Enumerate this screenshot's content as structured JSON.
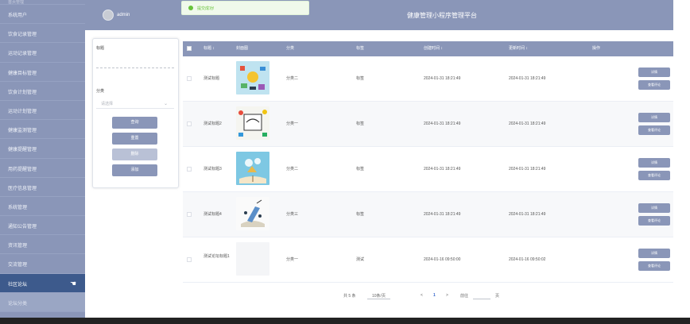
{
  "sidebar": {
    "items": [
      {
        "label": "首页管理"
      },
      {
        "label": "系统用户"
      },
      {
        "label": "饮食记录管理"
      },
      {
        "label": "运动记录管理"
      },
      {
        "label": "健康目标管理"
      },
      {
        "label": "饮食计划管理"
      },
      {
        "label": "运动计划管理"
      },
      {
        "label": "健康监测管理"
      },
      {
        "label": "健康提醒管理"
      },
      {
        "label": "用药提醒管理"
      },
      {
        "label": "医疗信息管理"
      },
      {
        "label": "系统管理"
      },
      {
        "label": "通知公告管理"
      },
      {
        "label": "资讯管理"
      },
      {
        "label": "交流管理"
      },
      {
        "label": "社区论坛"
      },
      {
        "label": "论坛分类"
      }
    ]
  },
  "header": {
    "admin_name": "admin",
    "app_title": "健康管理小程序管理平台"
  },
  "toast": {
    "text": "提交成功!"
  },
  "filter": {
    "title_label": "标题",
    "category_label": "分类",
    "category_placeholder": "请选择",
    "search_label": "查询",
    "reset_label": "重置",
    "delete_label": "删除",
    "add_label": "添加"
  },
  "table": {
    "headers": [
      "标题 ↕",
      "封面图",
      "分类",
      "标签",
      "创建时间 ↕",
      "更新时间 ↕",
      "操作"
    ],
    "rows": [
      {
        "title": "测试标题",
        "category": "分类二",
        "tag": "标签",
        "created": "2024-01-31 18:21:49",
        "updated": "2024-01-31 18:21:49"
      },
      {
        "title": "测试标题2",
        "category": "分类一",
        "tag": "标签",
        "created": "2024-01-31 18:21:49",
        "updated": "2024-01-31 18:21:49"
      },
      {
        "title": "测试标题3",
        "category": "分类二",
        "tag": "标签",
        "created": "2024-01-31 18:21:49",
        "updated": "2024-01-31 18:21:49"
      },
      {
        "title": "测试标题4",
        "category": "分类三",
        "tag": "标签",
        "created": "2024-01-31 18:21:49",
        "updated": "2024-01-31 18:21:49"
      },
      {
        "title": "测试论坛标题1",
        "category": "分类一",
        "tag": "测试",
        "created": "2024-01-16 09:50:00",
        "updated": "2024-01-16 09:50:02"
      }
    ],
    "detail_label": "详情",
    "comment_label": "查看评论"
  },
  "pagination": {
    "total": "共 5 条",
    "page_size": "10条/页",
    "prev": "<",
    "current_page": "1",
    "next": ">",
    "goto": "前往",
    "page_unit": "页"
  },
  "colors": {
    "primary": "#8a96b8",
    "active": "#3d5a8c",
    "success": "#67c23a"
  }
}
